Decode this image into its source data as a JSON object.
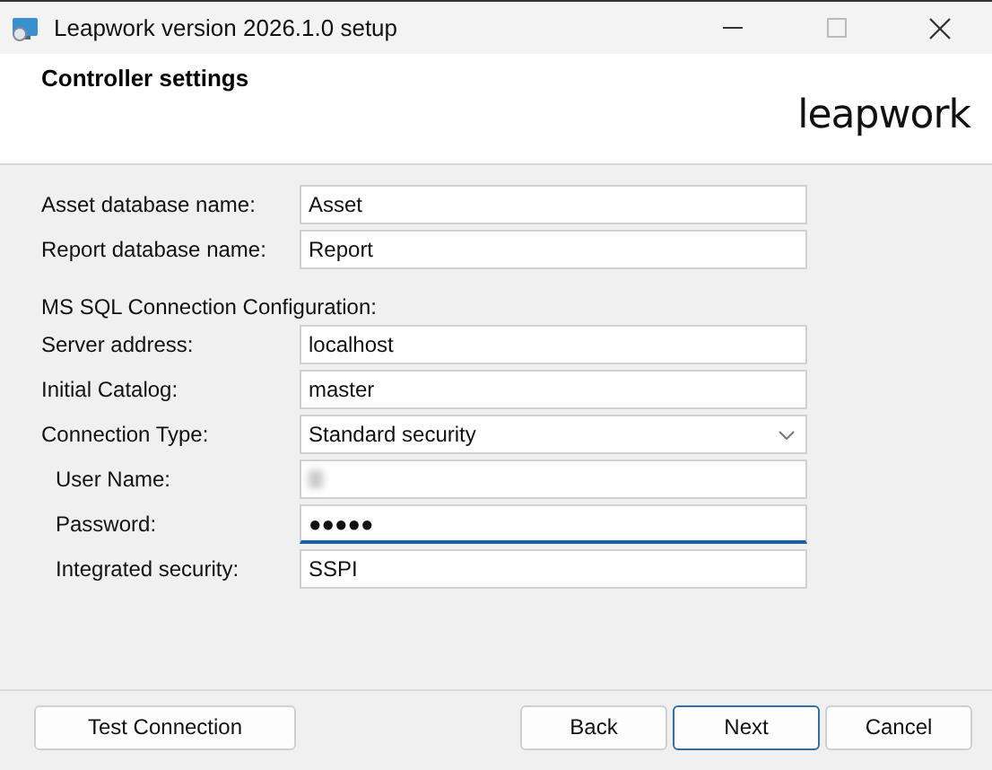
{
  "window": {
    "title": "Leapwork version 2026.1.0 setup"
  },
  "header": {
    "title": "Controller settings",
    "logo": "leapwork"
  },
  "fields": [
    {
      "kind": "text",
      "label": "Asset database name:",
      "value": "Asset",
      "indented": false,
      "focused": false
    },
    {
      "kind": "text",
      "label": "Report database name:",
      "value": "Report",
      "indented": false,
      "focused": false
    },
    {
      "kind": "heading",
      "label": "MS SQL Connection Configuration:"
    },
    {
      "kind": "text",
      "label": "Server address:",
      "value": "localhost",
      "indented": false,
      "focused": false
    },
    {
      "kind": "text",
      "label": "Initial Catalog:",
      "value": "master",
      "indented": false,
      "focused": false
    },
    {
      "kind": "select",
      "label": "Connection Type:",
      "value": "Standard security",
      "indented": false
    },
    {
      "kind": "blurred",
      "label": "User Name:",
      "indented": true,
      "focused": false
    },
    {
      "kind": "password",
      "label": "Password:",
      "value": "●●●●●",
      "indented": true,
      "focused": true
    },
    {
      "kind": "text",
      "label": "Integrated security:",
      "value": "SSPI",
      "indented": true,
      "focused": false
    }
  ],
  "left_buttons": [
    {
      "label": "Test Connection",
      "default": false
    }
  ],
  "buttons": [
    {
      "label": "Back",
      "default": false
    },
    {
      "label": "Next",
      "default": true
    },
    {
      "label": "Cancel",
      "default": false
    }
  ]
}
